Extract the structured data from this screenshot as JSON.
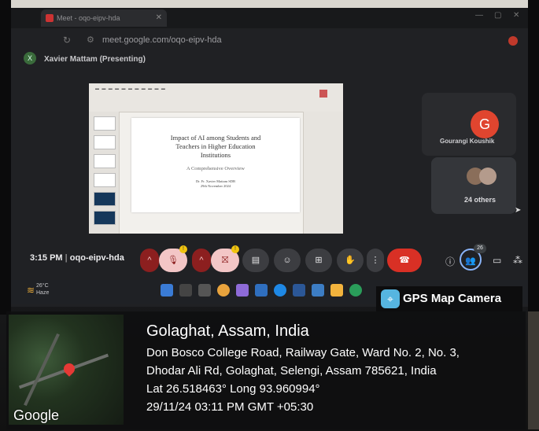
{
  "browser": {
    "tab_title": "Meet - oqo-eipv-hda",
    "url": "meet.google.com/oqo-eipv-hda"
  },
  "meet": {
    "presenter_initial": "X",
    "presenter_label": "Xavier Mattam (Presenting)",
    "slide": {
      "title": "Impact of AI among Students and Teachers in Higher Education Institutions",
      "subtitle": "A Comprehensive Overview",
      "author": "Dr. Fr. Xavier Mattam SDB",
      "date": "29th November 2024"
    },
    "participant": {
      "initial": "G",
      "name": "Gourangi Koushik",
      "avatar_color": "#e0452f"
    },
    "others_label": "24 others",
    "time": "3:15 PM",
    "meeting_code": "oqo-eipv-hda",
    "people_count": "26",
    "mic_badge": "!",
    "cam_badge": "!"
  },
  "taskbar": {
    "temperature": "26°C",
    "condition": "Haze"
  },
  "overlay": {
    "app_name": "GPS Map Camera",
    "location_title": "Golaghat, Assam, India",
    "address_line1": "Don Bosco College Road, Railway Gate, Ward No. 2, No. 3,",
    "address_line2": "Dhodar Ali Rd, Golaghat, Selengi, Assam 785621, India",
    "coordinates": "Lat 26.518463° Long 93.960994°",
    "datetime": "29/11/24 03:11 PM GMT +05:30",
    "map_label": "Google"
  }
}
